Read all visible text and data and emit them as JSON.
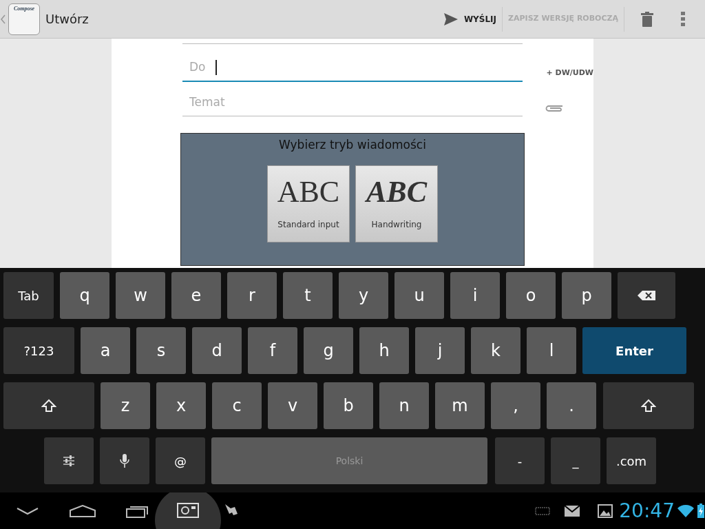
{
  "action_bar": {
    "title": "Utwórz",
    "app_icon_label": "Compose",
    "send_label": "WYŚLIJ",
    "draft_label": "ZAPISZ WERSJĘ ROBOCZĄ",
    "draft_disabled": true
  },
  "form": {
    "fields": [
      {
        "placeholder": "Do",
        "focused": true
      },
      {
        "placeholder": "Temat",
        "focused": false
      }
    ],
    "cc_label": "+ DW/UDW"
  },
  "mode_panel": {
    "title": "Wybierz tryb wiadomości",
    "options": [
      {
        "kind": "standard",
        "glyph": "ABC",
        "label": "Standard input"
      },
      {
        "kind": "handwriting",
        "glyph": "ABC",
        "label": "Handwriting"
      }
    ]
  },
  "keyboard": {
    "rows": [
      [
        {
          "kind": "tab",
          "label": "Tab"
        },
        {
          "kind": "char",
          "label": "q"
        },
        {
          "kind": "char",
          "label": "w"
        },
        {
          "kind": "char",
          "label": "e"
        },
        {
          "kind": "char",
          "label": "r"
        },
        {
          "kind": "char",
          "label": "t"
        },
        {
          "kind": "char",
          "label": "y"
        },
        {
          "kind": "char",
          "label": "u"
        },
        {
          "kind": "char",
          "label": "i"
        },
        {
          "kind": "char",
          "label": "o"
        },
        {
          "kind": "char",
          "label": "p"
        },
        {
          "kind": "backspace"
        }
      ],
      [
        {
          "kind": "symbols",
          "label": "?123"
        },
        {
          "kind": "char",
          "label": "a"
        },
        {
          "kind": "char",
          "label": "s"
        },
        {
          "kind": "char",
          "label": "d"
        },
        {
          "kind": "char",
          "label": "f"
        },
        {
          "kind": "char",
          "label": "g"
        },
        {
          "kind": "char",
          "label": "h"
        },
        {
          "kind": "char",
          "label": "j"
        },
        {
          "kind": "char",
          "label": "k"
        },
        {
          "kind": "char",
          "label": "l"
        },
        {
          "kind": "enter",
          "label": "Enter"
        }
      ],
      [
        {
          "kind": "shift"
        },
        {
          "kind": "char",
          "label": "z"
        },
        {
          "kind": "char",
          "label": "x"
        },
        {
          "kind": "char",
          "label": "c"
        },
        {
          "kind": "char",
          "label": "v"
        },
        {
          "kind": "char",
          "label": "b"
        },
        {
          "kind": "char",
          "label": "n"
        },
        {
          "kind": "char",
          "label": "m"
        },
        {
          "kind": "char",
          "label": ","
        },
        {
          "kind": "char",
          "label": "."
        },
        {
          "kind": "shift"
        }
      ],
      [
        {
          "kind": "settings"
        },
        {
          "kind": "mic"
        },
        {
          "kind": "func",
          "label": "@"
        },
        {
          "kind": "space",
          "label": "Polski"
        },
        {
          "kind": "func",
          "label": "-"
        },
        {
          "kind": "func",
          "label": "_"
        },
        {
          "kind": "func",
          "label": ".com"
        }
      ]
    ]
  },
  "status_bar": {
    "time": "20:47"
  }
}
